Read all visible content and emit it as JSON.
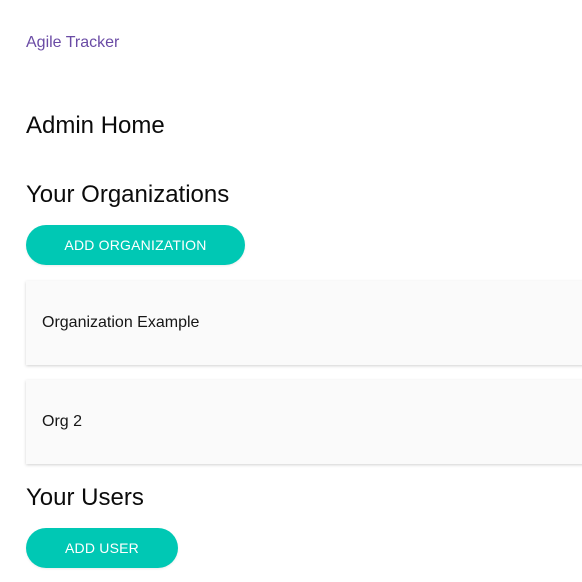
{
  "app": {
    "brand": "Agile Tracker"
  },
  "page": {
    "title": "Admin Home"
  },
  "organizations": {
    "heading": "Your Organizations",
    "add_button": "ADD ORGANIZATION",
    "items": [
      {
        "name": "Organization Example"
      },
      {
        "name": "Org 2"
      }
    ]
  },
  "users": {
    "heading": "Your Users",
    "add_button": "ADD USER"
  },
  "colors": {
    "brand_link": "#6a4ba5",
    "accent": "#00c8b4",
    "card_bg": "#fafafa"
  }
}
